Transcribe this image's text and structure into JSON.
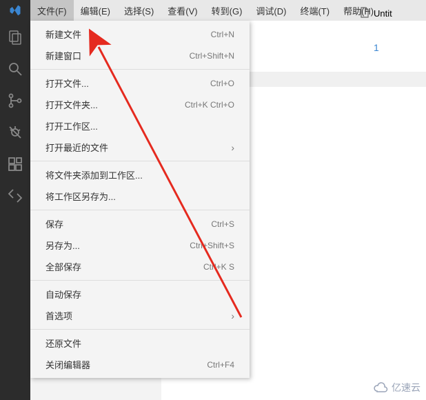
{
  "menubar": {
    "file": "文件(F)",
    "edit": "编辑(E)",
    "select": "选择(S)",
    "view": "查看(V)",
    "goto": "转到(G)",
    "debug": "调试(D)",
    "terminal": "终端(T)",
    "help": "帮助(H)"
  },
  "dropdown": {
    "new_file": "新建文件",
    "new_file_sc": "Ctrl+N",
    "new_window": "新建窗口",
    "new_window_sc": "Ctrl+Shift+N",
    "open_file": "打开文件...",
    "open_file_sc": "Ctrl+O",
    "open_folder": "打开文件夹...",
    "open_folder_sc": "Ctrl+K Ctrl+O",
    "open_ws": "打开工作区...",
    "open_recent": "打开最近的文件",
    "add_folder_ws": "将文件夹添加到工作区...",
    "save_ws_as": "将工作区另存为...",
    "save": "保存",
    "save_sc": "Ctrl+S",
    "save_as": "另存为...",
    "save_as_sc": "Ctrl+Shift+S",
    "save_all": "全部保存",
    "save_all_sc": "Ctrl+K S",
    "auto_save": "自动保存",
    "preferences": "首选项",
    "revert": "还原文件",
    "close_editor": "关闭编辑器",
    "close_editor_sc": "Ctrl+F4"
  },
  "editor": {
    "tab_label": "Untit",
    "line_number": "1"
  },
  "watermark": "亿速云"
}
